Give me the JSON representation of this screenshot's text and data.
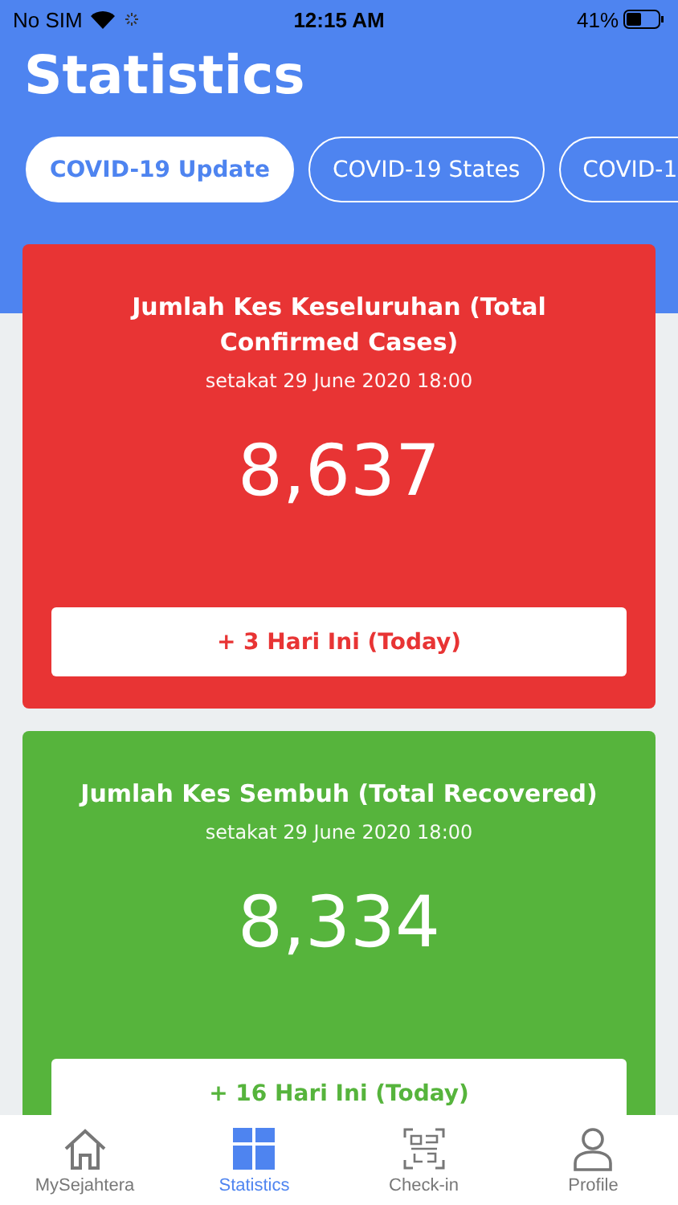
{
  "status_bar": {
    "carrier": "No SIM",
    "time": "12:15 AM",
    "battery": "41%"
  },
  "header": {
    "title": "Statistics"
  },
  "tabs": [
    {
      "label": "COVID-19 Update",
      "selected": true
    },
    {
      "label": "COVID-19 States",
      "selected": false
    },
    {
      "label": "COVID-1",
      "selected": false
    }
  ],
  "cards": [
    {
      "title": "Jumlah Kes Keseluruhan (Total Confirmed Cases)",
      "date": "setakat 29 June 2020 18:00",
      "count": "8,637",
      "today": "+ 3 Hari Ini (Today)",
      "color": "#e83434"
    },
    {
      "title": "Jumlah Kes Sembuh (Total Recovered)",
      "date": "setakat 29 June 2020 18:00",
      "count": "8,334",
      "today": "+ 16 Hari Ini (Today)",
      "color": "#56b43c"
    }
  ],
  "bottom_nav": [
    {
      "label": "MySejahtera",
      "selected": false
    },
    {
      "label": "Statistics",
      "selected": true
    },
    {
      "label": "Check-in",
      "selected": false
    },
    {
      "label": "Profile",
      "selected": false
    }
  ]
}
